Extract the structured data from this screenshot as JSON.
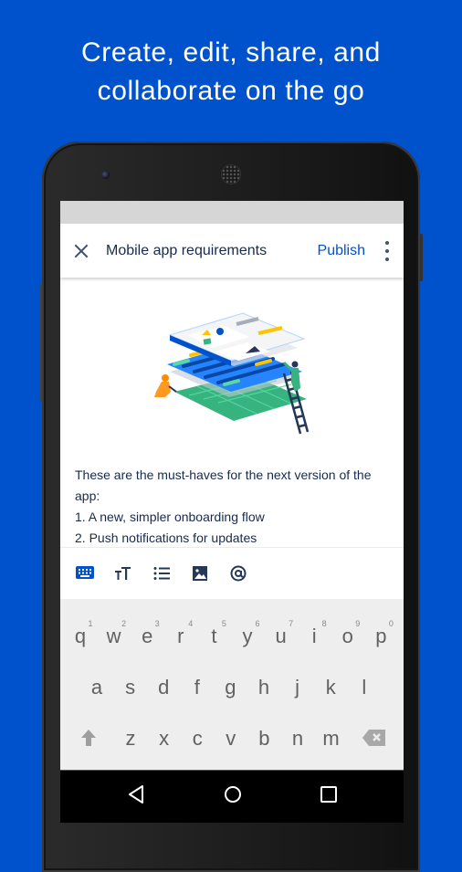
{
  "headline": {
    "line1": "Create, edit, share, and",
    "line2": "collaborate on the go"
  },
  "colors": {
    "background": "#0052CC",
    "accent": "#0052CC",
    "text_primary": "#172B4D"
  },
  "appbar": {
    "close_icon": "close-icon",
    "title": "Mobile app requirements",
    "publish_label": "Publish",
    "more_icon": "more-vert-icon"
  },
  "document": {
    "illustration": "layers-illustration",
    "paragraphs": [
      "These are the must-haves for the next version of the",
      "app:",
      "1. A new, simpler onboarding flow",
      "2. Push notifications for updates"
    ]
  },
  "editor_toolbar": {
    "items": [
      {
        "icon": "keyboard-icon",
        "active": true
      },
      {
        "icon": "text-size-icon",
        "active": false
      },
      {
        "icon": "bulleted-list-icon",
        "active": false
      },
      {
        "icon": "image-icon",
        "active": false
      },
      {
        "icon": "mention-icon",
        "active": false
      }
    ]
  },
  "keyboard": {
    "row1": [
      "q",
      "w",
      "e",
      "r",
      "t",
      "y",
      "u",
      "i",
      "o",
      "p"
    ],
    "row1_hints": [
      "1",
      "2",
      "3",
      "4",
      "5",
      "6",
      "7",
      "8",
      "9",
      "0"
    ],
    "row2": [
      "a",
      "s",
      "d",
      "f",
      "g",
      "h",
      "j",
      "k",
      "l"
    ],
    "row3": [
      "z",
      "x",
      "c",
      "v",
      "b",
      "n",
      "m"
    ],
    "shift_icon": "shift-icon",
    "backspace_icon": "backspace-icon"
  },
  "navbar": {
    "back_icon": "back-icon",
    "home_icon": "home-icon",
    "recents_icon": "recents-icon"
  }
}
